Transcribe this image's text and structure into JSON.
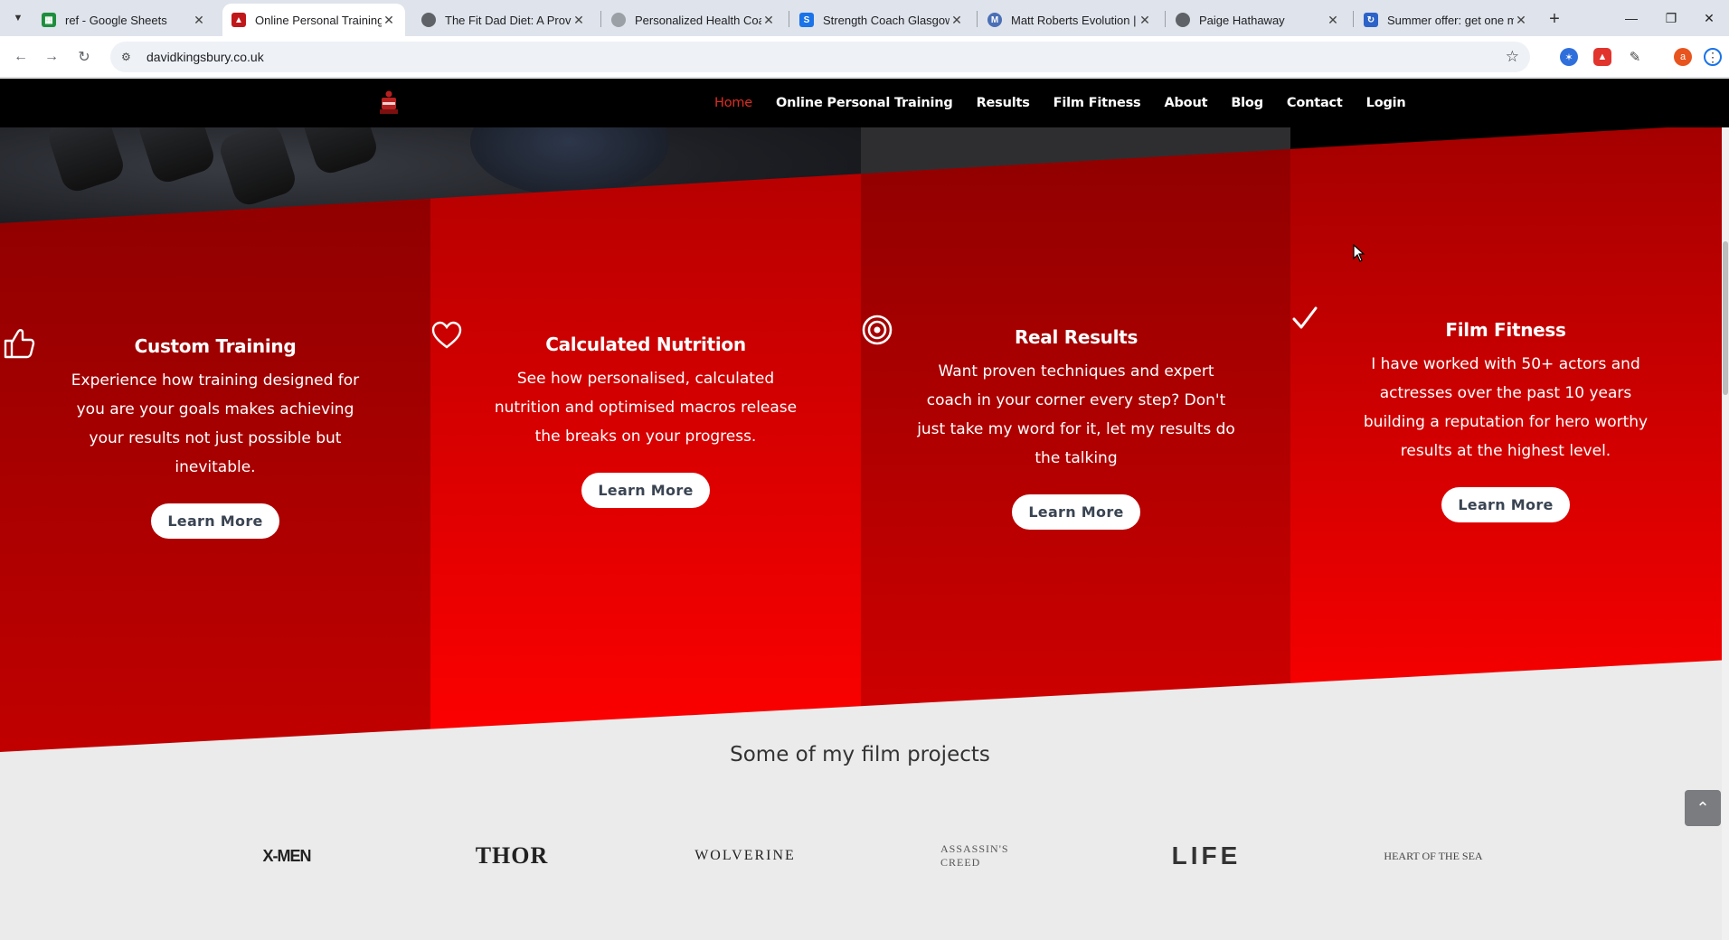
{
  "browser": {
    "tabs": [
      {
        "title": "ref - Google Sheets",
        "favicon": "sheets-icon",
        "color": "#1e8e3e"
      },
      {
        "title": "Online Personal Training &",
        "favicon": "kb-icon",
        "color": "#c0181a",
        "active": true
      },
      {
        "title": "The Fit Dad Diet: A Proven",
        "favicon": "globe-icon",
        "color": "#5f6368"
      },
      {
        "title": "Personalized Health Coach",
        "favicon": "globe-icon",
        "color": "#5f6368"
      },
      {
        "title": "Strength Coach Glasgow",
        "favicon": "s-icon",
        "color": "#1a73e8"
      },
      {
        "title": "Matt Roberts Evolution |",
        "favicon": "mr-icon",
        "color": "#4a6fb5"
      },
      {
        "title": "Paige Hathaway",
        "favicon": "globe-icon",
        "color": "#5f6368"
      },
      {
        "title": "Summer offer: get one m",
        "favicon": "offer-icon",
        "color": "#2d63c8"
      }
    ],
    "url": "davidkingsbury.co.uk",
    "profile_letter": "a"
  },
  "site": {
    "nav": [
      {
        "label": "Home",
        "current": true
      },
      {
        "label": "Online Personal Training"
      },
      {
        "label": "Results"
      },
      {
        "label": "Film Fitness"
      },
      {
        "label": "About"
      },
      {
        "label": "Blog"
      },
      {
        "label": "Contact"
      },
      {
        "label": "Login"
      }
    ],
    "features": [
      {
        "icon": "thumbs-up-icon",
        "title": "Custom Training",
        "text": "Experience how training designed for you are your goals makes achieving your results not just possible but inevitable.",
        "button": "Learn More"
      },
      {
        "icon": "heart-icon",
        "title": "Calculated Nutrition",
        "text": "See how personalised, calculated nutrition and optimised macros release the breaks on your progress.",
        "button": "Learn More"
      },
      {
        "icon": "target-icon",
        "title": "Real Results",
        "text": "Want proven techniques and expert coach in your corner every step? Don't just take my word for it, let my results do the talking",
        "button": "Learn More"
      },
      {
        "icon": "checkmark-icon",
        "title": "Film Fitness",
        "text": "I have worked with 50+ actors and actresses over the past 10 years building a reputation for hero worthy results at the highest level.",
        "button": "Learn More"
      }
    ],
    "film_heading": "Some of my film projects",
    "films": [
      "X-MEN",
      "THOR",
      "WOLVERINE",
      "ASSASSIN'S CREED",
      "LIFE",
      "HEART OF THE SEA"
    ],
    "colors": {
      "red_dark": "#8e0000",
      "red_light": "#f00000",
      "nav_active": "#e02b20"
    }
  }
}
